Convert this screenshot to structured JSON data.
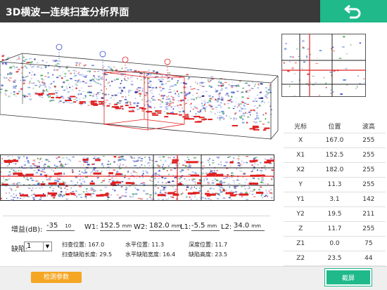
{
  "header": {
    "title": "3D横波—连续扫查分析界面",
    "back_icon": "undo-arrow-icon"
  },
  "table": {
    "headers": [
      "光标",
      "位置",
      "波高"
    ],
    "rows": [
      [
        "X",
        "167.0",
        "255"
      ],
      [
        "X1",
        "152.5",
        "255"
      ],
      [
        "X2",
        "182.0",
        "255"
      ],
      [
        "Y",
        "11.3",
        "255"
      ],
      [
        "Y1",
        "3.1",
        "142"
      ],
      [
        "Y2",
        "19.5",
        "211"
      ],
      [
        "Z",
        "11.7",
        "255"
      ],
      [
        "Z1",
        "0.0",
        "75"
      ],
      [
        "Z2",
        "23.5",
        "44"
      ]
    ]
  },
  "controls": {
    "gain_label": "增益(dB):",
    "gain_value": "-35",
    "gain_step": "10",
    "w1_label": "W1:",
    "w1_value": "152.5",
    "w2_label": "W2:",
    "w2_value": "182.0",
    "l1_label": "L1:",
    "l1_value": "-5.5",
    "l2_label": "L2:",
    "l2_value": "34.0",
    "unit": "mm",
    "defect_label": "缺陷:",
    "defect_value": "1"
  },
  "stats": {
    "scan_pos_label": "扫查位置:",
    "scan_pos": "167.0",
    "h_pos_label": "水平位置:",
    "h_pos": "11.3",
    "depth_pos_label": "深度位置:",
    "depth_pos": "11.7",
    "scan_len_label": "扫查缺陷长度:",
    "scan_len": "29.5",
    "h_width_label": "水平缺陷宽度:",
    "h_width": "16.4",
    "defect_height_label": "缺陷高度:",
    "defect_height": "23.5"
  },
  "footer": {
    "params_label": "检测参数",
    "screenshot_label": "截屏"
  },
  "colors": {
    "accent": "#1fb98a",
    "orange": "#f5a623",
    "titlebar": "#3a3a3a",
    "red": "#e02020",
    "blue": "#3a4bd0"
  }
}
